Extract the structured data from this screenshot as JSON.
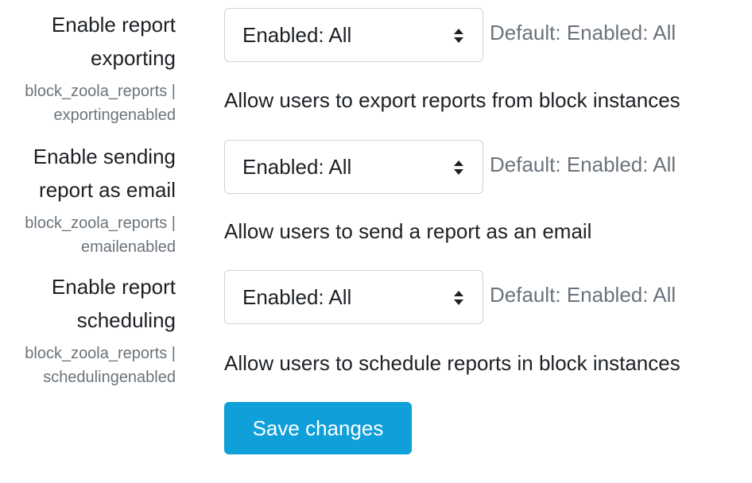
{
  "settings": [
    {
      "title_line1": "Enable report",
      "title_line2": "exporting",
      "key_line1": "block_zoola_reports |",
      "key_line2": "exportingenabled",
      "selected": "Enabled: All",
      "default": "Default: Enabled: All",
      "description": "Allow users to export reports from block instances"
    },
    {
      "title_line1": "Enable sending",
      "title_line2": "report as email",
      "key_line1": "block_zoola_reports |",
      "key_line2": "emailenabled",
      "selected": "Enabled: All",
      "default": "Default: Enabled: All",
      "description": "Allow users to send a report as an email"
    },
    {
      "title_line1": "Enable report",
      "title_line2": "scheduling",
      "key_line1": "block_zoola_reports |",
      "key_line2": "schedulingenabled",
      "selected": "Enabled: All",
      "default": "Default: Enabled: All",
      "description": "Allow users to schedule reports in block instances"
    }
  ],
  "save_button": {
    "label": "Save changes"
  },
  "icons": {
    "select_arrow": "chevron-up-down-icon"
  },
  "colors": {
    "primary_button": "#0f9fd9",
    "muted_text": "#6a737b",
    "body_text": "#1d2125",
    "input_border": "#ced4da"
  }
}
